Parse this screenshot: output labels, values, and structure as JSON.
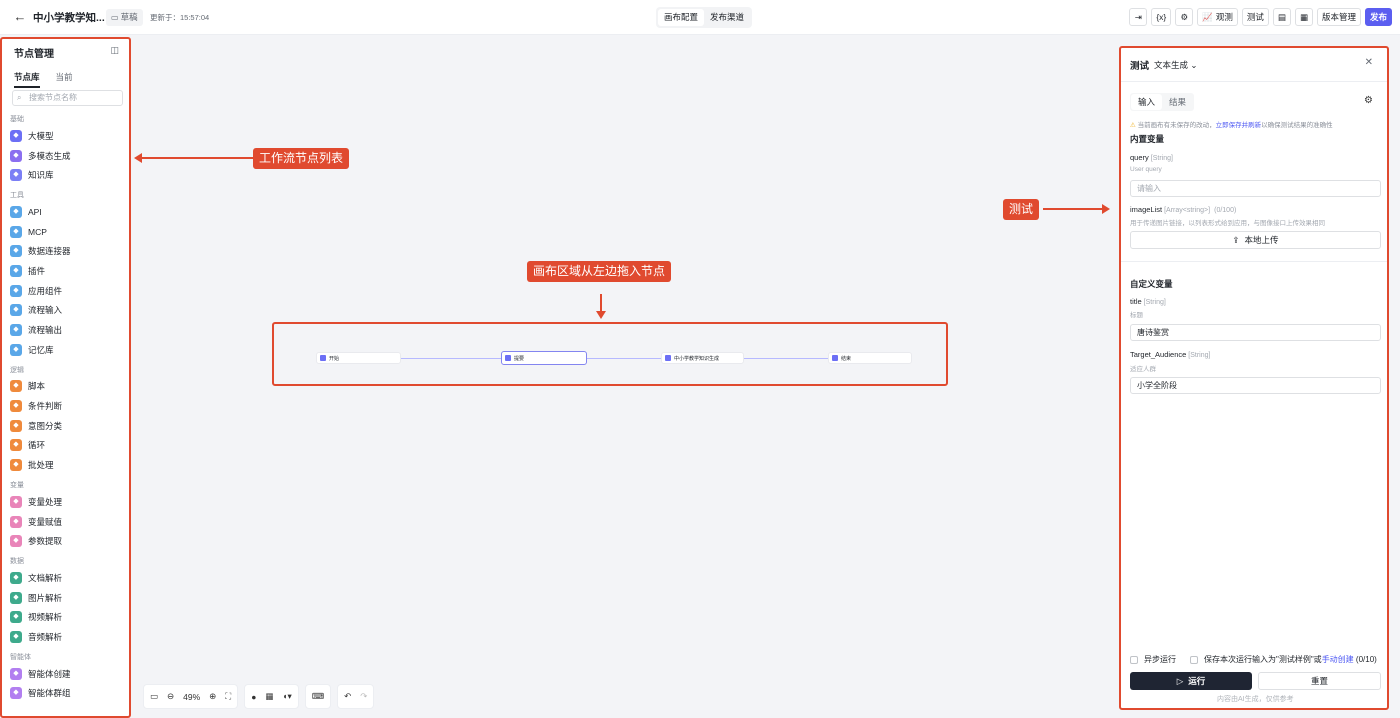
{
  "header": {
    "title": "中小学教学知...",
    "draft_label": "草稿",
    "updated": "更新于：15:57:04",
    "tabs": [
      "画布配置",
      "发布渠道"
    ],
    "observe_label": "观测",
    "test_label": "测试",
    "version_label": "版本管理",
    "publish_label": "发布"
  },
  "sidebar": {
    "title": "节点管理",
    "tabs": [
      "节点库",
      "当前"
    ],
    "search_placeholder": "搜索节点名称",
    "groups": [
      {
        "name": "基础",
        "items": [
          {
            "label": "大模型",
            "color": "#6c6ff5",
            "icon": "sparkle-icon"
          },
          {
            "label": "多模态生成",
            "color": "#8b6ff0",
            "icon": "image-gen-icon"
          },
          {
            "label": "知识库",
            "color": "#7b7ff5",
            "icon": "book-icon"
          }
        ]
      },
      {
        "name": "工具",
        "items": [
          {
            "label": "API",
            "color": "#5aa7e8",
            "icon": "link-icon"
          },
          {
            "label": "MCP",
            "color": "#5aa7e8",
            "icon": "plug-icon"
          },
          {
            "label": "数据连接器",
            "color": "#5aa7e8",
            "icon": "database-icon"
          },
          {
            "label": "插件",
            "color": "#5aa7e8",
            "icon": "puzzle-icon"
          },
          {
            "label": "应用组件",
            "color": "#5aa7e8",
            "icon": "component-icon"
          },
          {
            "label": "流程输入",
            "color": "#5aa7e8",
            "icon": "input-icon"
          },
          {
            "label": "流程输出",
            "color": "#5aa7e8",
            "icon": "output-icon"
          },
          {
            "label": "记忆库",
            "color": "#5aa7e8",
            "icon": "memory-icon"
          }
        ]
      },
      {
        "name": "逻辑",
        "items": [
          {
            "label": "脚本",
            "color": "#ef8a3c",
            "icon": "code-icon"
          },
          {
            "label": "条件判断",
            "color": "#ef8a3c",
            "icon": "branch-icon"
          },
          {
            "label": "意图分类",
            "color": "#ef8a3c",
            "icon": "intent-icon"
          },
          {
            "label": "循环",
            "color": "#ef8a3c",
            "icon": "loop-icon"
          },
          {
            "label": "批处理",
            "color": "#ef8a3c",
            "icon": "batch-icon"
          }
        ]
      },
      {
        "name": "变量",
        "items": [
          {
            "label": "变量处理",
            "color": "#e985b9",
            "icon": "variable-icon"
          },
          {
            "label": "变量赋值",
            "color": "#e985b9",
            "icon": "assign-icon"
          },
          {
            "label": "参数提取",
            "color": "#e985b9",
            "icon": "extract-icon"
          }
        ]
      },
      {
        "name": "数据",
        "items": [
          {
            "label": "文档解析",
            "color": "#3eaa8c",
            "icon": "document-icon"
          },
          {
            "label": "图片解析",
            "color": "#3eaa8c",
            "icon": "picture-icon"
          },
          {
            "label": "视频解析",
            "color": "#3eaa8c",
            "icon": "video-icon"
          },
          {
            "label": "音频解析",
            "color": "#3eaa8c",
            "icon": "audio-icon"
          }
        ]
      },
      {
        "name": "智能体",
        "items": [
          {
            "label": "智能体创建",
            "color": "#b27ff0",
            "icon": "agent-icon"
          },
          {
            "label": "智能体群组",
            "color": "#b27ff0",
            "icon": "agent-group-icon"
          }
        ]
      }
    ]
  },
  "canvas": {
    "nodes": [
      "开始",
      "提要",
      "中小学教学知识生成",
      "结束"
    ],
    "zoom": "49%"
  },
  "annotations": {
    "left": "工作流节点列表",
    "canvas": "画布区域从左边拖入节点",
    "right": "测试"
  },
  "test_panel": {
    "title": "测试",
    "mode": "文本生成",
    "tabs": [
      "输入",
      "结果"
    ],
    "warning_prefix": "当前画布有未保存的改动，",
    "warning_link": "立即保存并刷新",
    "warning_suffix": "以确保测试结果的准确性",
    "builtin_section": "内置变量",
    "query_label": "query",
    "query_type": "[String]",
    "query_desc": "User query",
    "query_placeholder": "请输入",
    "image_label": "imageList",
    "image_type": "[Array<string>]",
    "image_count": "(0/100)",
    "image_desc": "用于传递图片链接，以列表形式给到应用，与图像接口上传效果相同",
    "upload_label": "本地上传",
    "custom_section": "自定义变量",
    "title_label": "title",
    "title_type": "[String]",
    "title_desc": "标题",
    "title_value": "唐诗鉴赏",
    "aud_label": "Target_Audience",
    "aud_type": "[String]",
    "aud_desc": "适应人群",
    "aud_value": "小学全阶段",
    "async_label": "异步运行",
    "save_label": "保存本次运行输入为\"测试样例\"或",
    "save_link": "手动创建",
    "save_count": "(0/10)",
    "run_label": "运行",
    "reset_label": "重置",
    "disclaimer": "内容由AI生成，仅供参考"
  }
}
